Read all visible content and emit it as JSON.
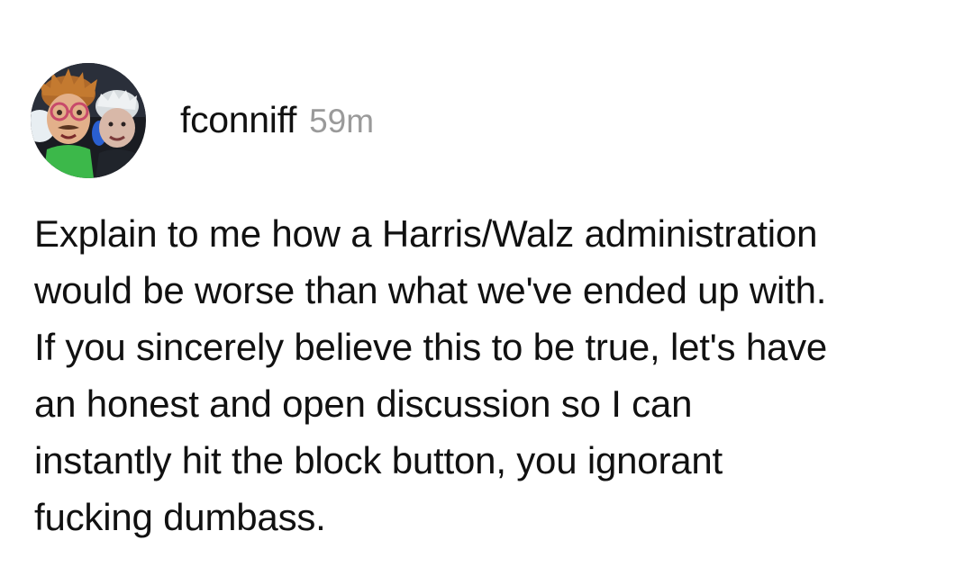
{
  "post": {
    "username": "fconniff",
    "timestamp": "59m",
    "avatar_icon": "profile-avatar-two-puppets",
    "text_lines": [
      "Explain to me how a Harris/Walz administration",
      "would be worse than what we've ended up with.",
      "If you sincerely believe this to be true, let's have",
      "an honest and open discussion so I can",
      "instantly hit the block button, you ignorant",
      "fucking dumbass."
    ]
  }
}
